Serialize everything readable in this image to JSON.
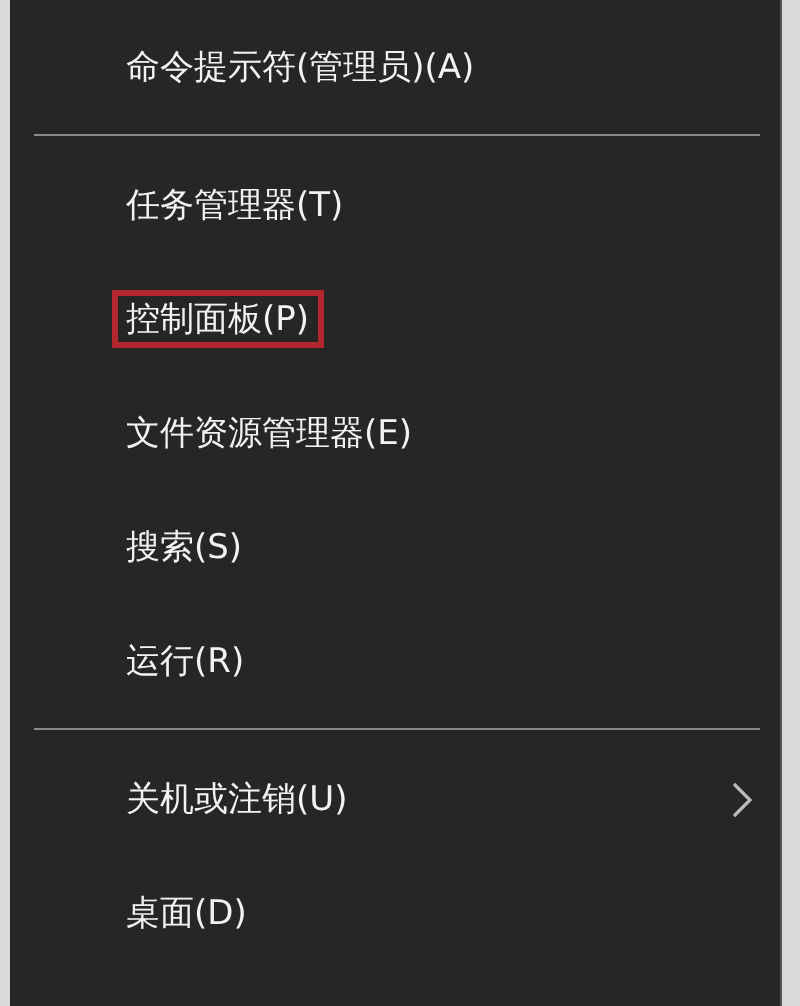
{
  "menu": {
    "entries": [
      {
        "kind": "item",
        "label": "命令提示符(管理员)(A)",
        "highlighted": false,
        "submenu": false
      },
      {
        "kind": "separator"
      },
      {
        "kind": "item",
        "label": "任务管理器(T)",
        "highlighted": false,
        "submenu": false
      },
      {
        "kind": "item",
        "label": "控制面板(P)",
        "highlighted": true,
        "submenu": false
      },
      {
        "kind": "item",
        "label": "文件资源管理器(E)",
        "highlighted": false,
        "submenu": false
      },
      {
        "kind": "item",
        "label": "搜索(S)",
        "highlighted": false,
        "submenu": false
      },
      {
        "kind": "item",
        "label": "运行(R)",
        "highlighted": false,
        "submenu": false
      },
      {
        "kind": "separator"
      },
      {
        "kind": "item",
        "label": "关机或注销(U)",
        "highlighted": false,
        "submenu": true
      },
      {
        "kind": "item",
        "label": "桌面(D)",
        "highlighted": false,
        "submenu": false
      }
    ]
  }
}
